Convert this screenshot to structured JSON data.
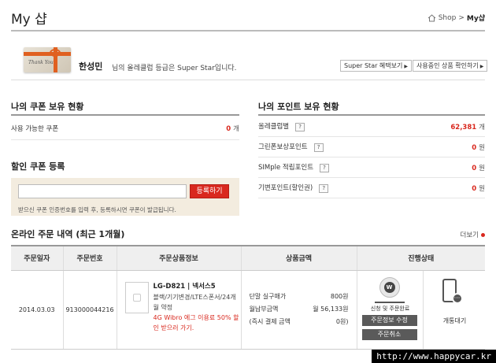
{
  "page": {
    "title": "My 샵"
  },
  "breadcrumb": {
    "home": "Shop",
    "separator": ">",
    "current": "My샵"
  },
  "member": {
    "card_text": "Thank You",
    "name": "한성민",
    "message": "님의 올레클럽 등급은 Super Star입니다.",
    "benefit_button": "Super Star 혜택보기",
    "products_button": "사용중인 상품 확인하기"
  },
  "coupons": {
    "title": "나의 쿠폰 보유 현황",
    "label": "사용 가능한 쿠폰",
    "value": "0",
    "unit": "개"
  },
  "points": {
    "title": "나의 포인트 보유 현황",
    "rows": [
      {
        "label": "올레클럽별",
        "value": "62,381",
        "unit": "개"
      },
      {
        "label": "그린폰보상포인트",
        "value": "0",
        "unit": "원"
      },
      {
        "label": "SIMple 적립포인트",
        "value": "0",
        "unit": "원"
      },
      {
        "label": "기변포인트(할인권)",
        "value": "0",
        "unit": "원"
      }
    ],
    "help_label": "?"
  },
  "coupon_register": {
    "title": "할인 쿠폰 등록",
    "input_value": "",
    "button": "등록하기",
    "help": "받으신 쿠폰 인증번호를 입력 후, 등록하시면 쿠폰이 발급됩니다."
  },
  "orders": {
    "title": "온라인 주문 내역 (최근 1개월)",
    "more": "더보기",
    "headers": [
      "주문일자",
      "주문번호",
      "주문상품정보",
      "상품금액",
      "진행상태"
    ],
    "row": {
      "date": "2014.03.03",
      "number": "913000044216",
      "product_name": "LG-D821 | 넥서스5",
      "product_options": "블랙/기기변경/LTE스폰서/24개월 약정",
      "promo": "4G Wibro 에그 이용료 50% 할인 받으러 가기.",
      "price_lines": [
        {
          "label": "단말 실구매가",
          "value": "800원"
        },
        {
          "label": "월납부금액",
          "value": "월 56,133원"
        },
        {
          "label": "(즉시 결제 금액",
          "value": "0원)"
        }
      ],
      "status_icon_label": "W",
      "status_text": "신청 및 주문완료",
      "edit_button": "주문정보 수정",
      "cancel_button": "주문취소",
      "waiting_text": "개통대기"
    }
  },
  "watermark": "http://www.happycar.kr",
  "colors": {
    "accent": "#d9281e",
    "coupon_bg": "#f3ecdf",
    "header_bg": "#efefef"
  }
}
